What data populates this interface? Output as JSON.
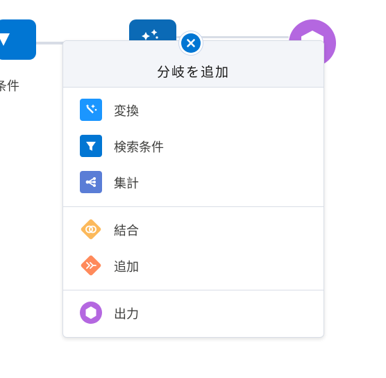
{
  "canvas": {
    "filter_node_label": "条件",
    "connector_color": "#d8dde6",
    "filter_node_icon": "filter-icon",
    "transform_node_icon": "magic-wand-icon",
    "output_node_icon": "hexagon-icon"
  },
  "popover": {
    "title": "分岐を追加",
    "close_icon": "close-icon",
    "groups": [
      {
        "items": [
          {
            "label": "変換",
            "icon": "magic-wand-icon",
            "color": "#1b96ff"
          },
          {
            "label": "検索条件",
            "icon": "filter-icon",
            "color": "#0176d3"
          },
          {
            "label": "集計",
            "icon": "aggregate-icon",
            "color": "#5a7dd6"
          }
        ]
      },
      {
        "items": [
          {
            "label": "結合",
            "icon": "join-icon",
            "color": "#fcb95b"
          },
          {
            "label": "追加",
            "icon": "append-icon",
            "color": "#ff8a5b"
          }
        ]
      },
      {
        "items": [
          {
            "label": "出力",
            "icon": "hexagon-icon",
            "color": "#b467e0"
          }
        ]
      }
    ]
  }
}
